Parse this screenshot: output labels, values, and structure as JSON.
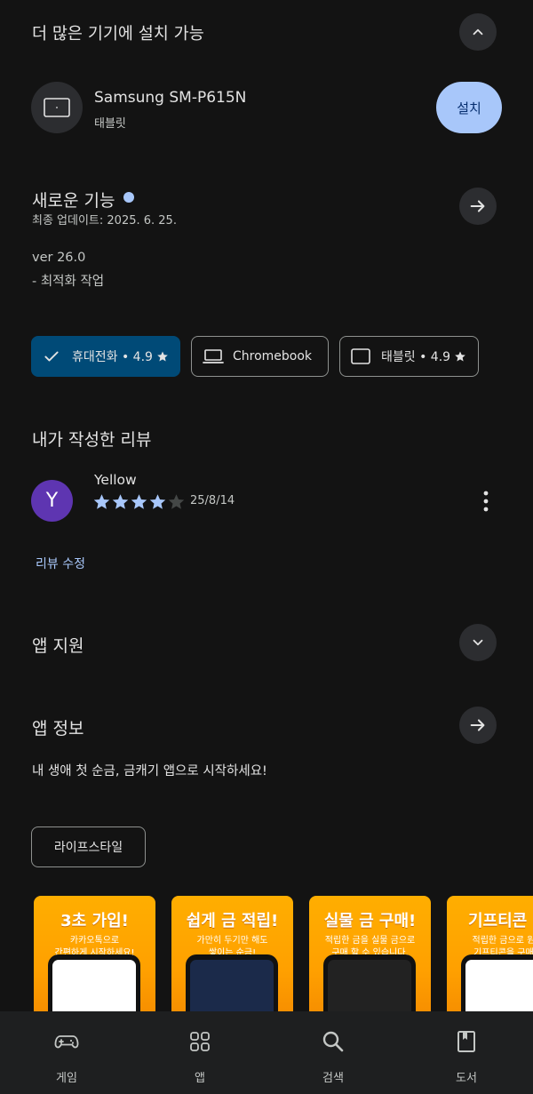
{
  "more_devices": {
    "title": "더 많은 기기에 설치 가능"
  },
  "device": {
    "name": "Samsung SM-P615N",
    "type": "태블릿",
    "install_label": "설치"
  },
  "whats_new": {
    "title": "새로운 기능",
    "updated": "최종 업데이트: 2025. 6. 25.",
    "version": "ver 26.0",
    "note": "- 최적화 작업"
  },
  "chips": [
    {
      "label": "휴대전화 • 4.9",
      "selected": true
    },
    {
      "label": "Chromebook",
      "selected": false
    },
    {
      "label": "태블릿 • 4.9",
      "selected": false
    }
  ],
  "my_review": {
    "title": "내가 작성한 리뷰",
    "avatar_letter": "Y",
    "avatar_color": "#5e35b1",
    "user": "Yellow",
    "rating": 4,
    "max_rating": 5,
    "date": "25/8/14",
    "edit_label": "리뷰 수정"
  },
  "app_support": {
    "title": "앱 지원"
  },
  "app_info": {
    "title": "앱 정보",
    "description": "내 생애 첫 순금, 금캐기 앱으로 시작하세요!",
    "category_chip": "라이프스타일"
  },
  "screenshots": [
    {
      "title": "3초 가입!",
      "desc": "카카오톡으로\n간편하게 시작하세요!"
    },
    {
      "title": "쉽게 금 적립!",
      "desc": "가만히 두기만 해도\n쌓이는 순금!"
    },
    {
      "title": "실물 금 구매!",
      "desc": "적립한 금을 실물 금으로\n구매 할 수 있습니다."
    },
    {
      "title": "기프티콘 구",
      "desc": "적립한 금으로 원하\n기프티콘을 구매하"
    }
  ],
  "bottom_nav": [
    {
      "label": "게임",
      "icon": "gamepad-icon"
    },
    {
      "label": "앱",
      "icon": "apps-grid-icon"
    },
    {
      "label": "검색",
      "icon": "search-icon"
    },
    {
      "label": "도서",
      "icon": "book-icon"
    }
  ],
  "colors": {
    "accent_blue": "#a8c7fa",
    "chip_selected_bg": "#004a77",
    "star": "#a8c7fa",
    "link": "#a8c7fa"
  }
}
